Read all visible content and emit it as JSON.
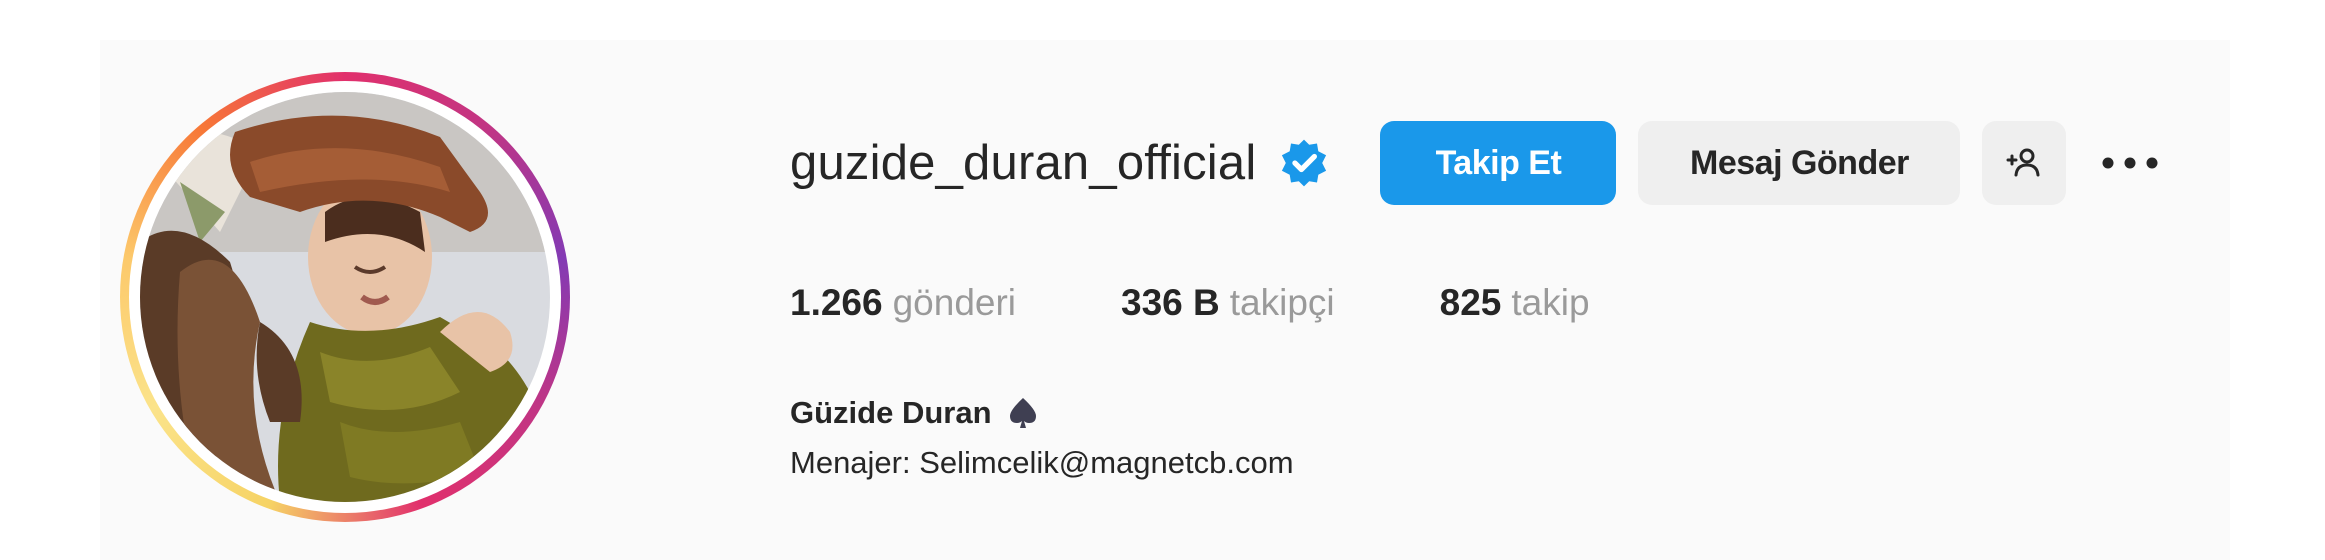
{
  "profile": {
    "username": "guzide_duran_official",
    "verified": true,
    "accent_color": "#1a98ea",
    "avatar_icon": "profile-photo-woman-in-hat"
  },
  "actions": {
    "follow_label": "Takip Et",
    "message_label": "Mesaj Gönder",
    "add_user_icon": "person-plus-icon",
    "more_icon": "ellipsis-icon"
  },
  "stats": [
    {
      "value": "1.266",
      "label": "gönderi"
    },
    {
      "value": "336 B",
      "label": "takipçi"
    },
    {
      "value": "825",
      "label": "takip"
    }
  ],
  "bio": {
    "display_name": "Güzide Duran",
    "name_icon": "spade-icon",
    "line": "Menajer: Selimcelik@magnetcb.com"
  }
}
